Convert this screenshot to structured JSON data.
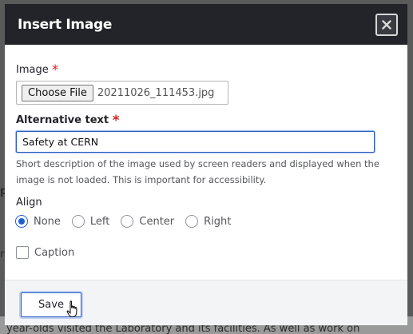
{
  "dialog": {
    "title": "Insert Image",
    "close_icon": "close-icon",
    "required_marker": "*"
  },
  "image_field": {
    "label": "Image",
    "choose_button": "Choose File",
    "file_name": "20211026_111453.jpg"
  },
  "alt_field": {
    "label": "Alternative text",
    "value": "Safety at CERN",
    "help": "Short description of the image used by screen readers and displayed when the image is not loaded. This is important for accessibility."
  },
  "align": {
    "label": "Align",
    "options": [
      "None",
      "Left",
      "Center",
      "Right"
    ],
    "selected": "None"
  },
  "caption": {
    "label": "Caption",
    "checked": false
  },
  "footer": {
    "save_label": "Save"
  },
  "background": {
    "left_fragment_1": "p",
    "left_fragment_2": "n)",
    "bottom_text": "year-olds visited the Laboratory and its facilities. As well as work on"
  },
  "colors": {
    "titlebar": "#232429",
    "accent": "#1b5fd6",
    "required": "#d72222",
    "footer_bg": "#f3f4f6"
  }
}
